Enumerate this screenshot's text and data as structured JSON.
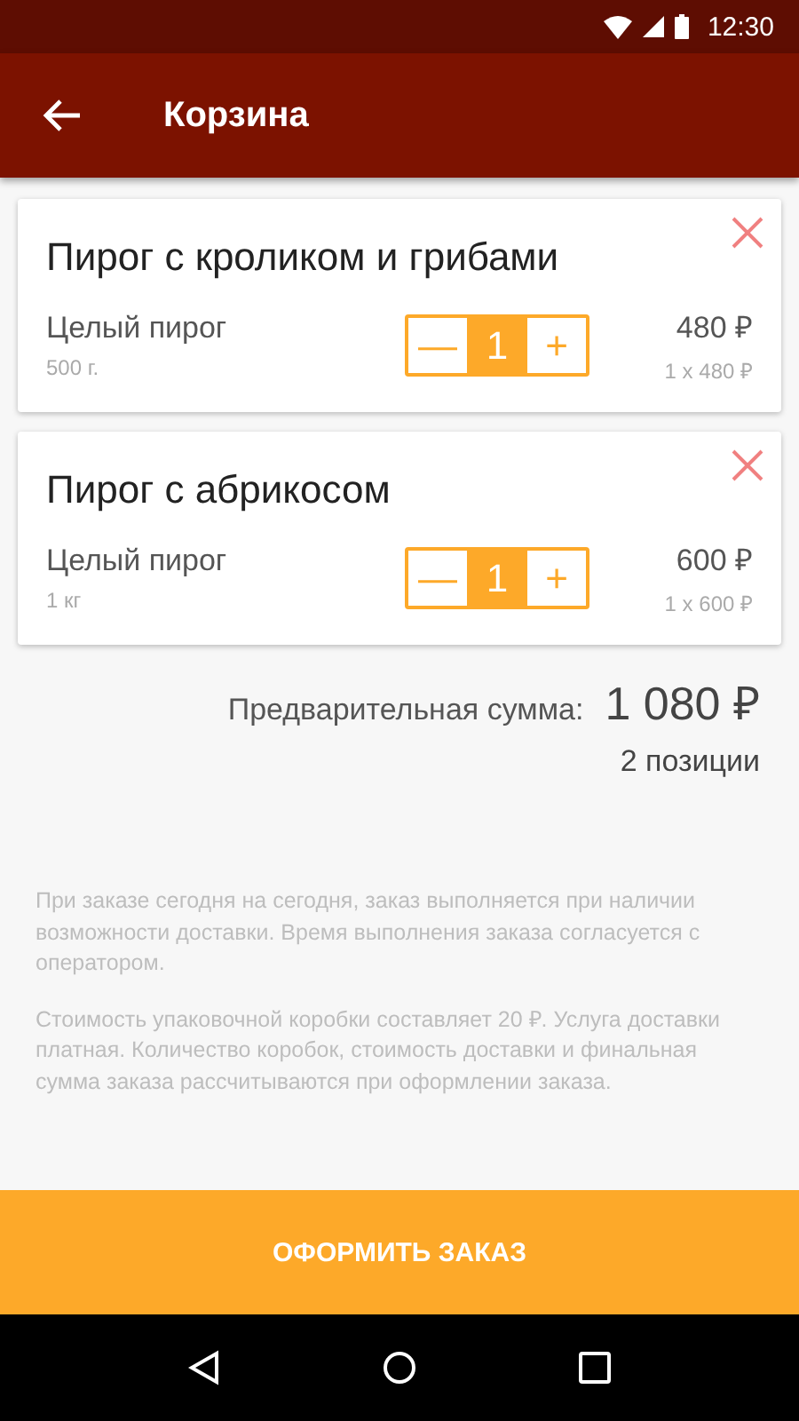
{
  "status_bar": {
    "time": "12:30"
  },
  "app_bar": {
    "title": "Корзина"
  },
  "items": [
    {
      "name": "Пирог с кроликом и грибами",
      "variant": "Целый пирог",
      "weight": "500 г.",
      "minus": "—",
      "quantity": "1",
      "plus": "+",
      "price": "480 ₽",
      "unit_price": "1 x 480 ₽"
    },
    {
      "name": "Пирог с абрикосом",
      "variant": "Целый пирог",
      "weight": "1 кг",
      "minus": "—",
      "quantity": "1",
      "plus": "+",
      "price": "600 ₽",
      "unit_price": "1 x 600 ₽"
    }
  ],
  "summary": {
    "label": "Предварительная сумма:",
    "total": "1 080 ₽",
    "count": "2 позиции"
  },
  "notes": [
    "При заказе сегодня на сегодня, заказ выполняется при наличии возможности доставки. Время выполнения заказа согласуется с оператором.",
    "Стоимость упаковочной коробки составляет 20 ₽. Услуга доставки платная. Количество коробок, стоимость доставки и финальная сумма заказа рассчитываются при оформлении заказа."
  ],
  "checkout_button": "ОФОРМИТЬ ЗАКАЗ"
}
